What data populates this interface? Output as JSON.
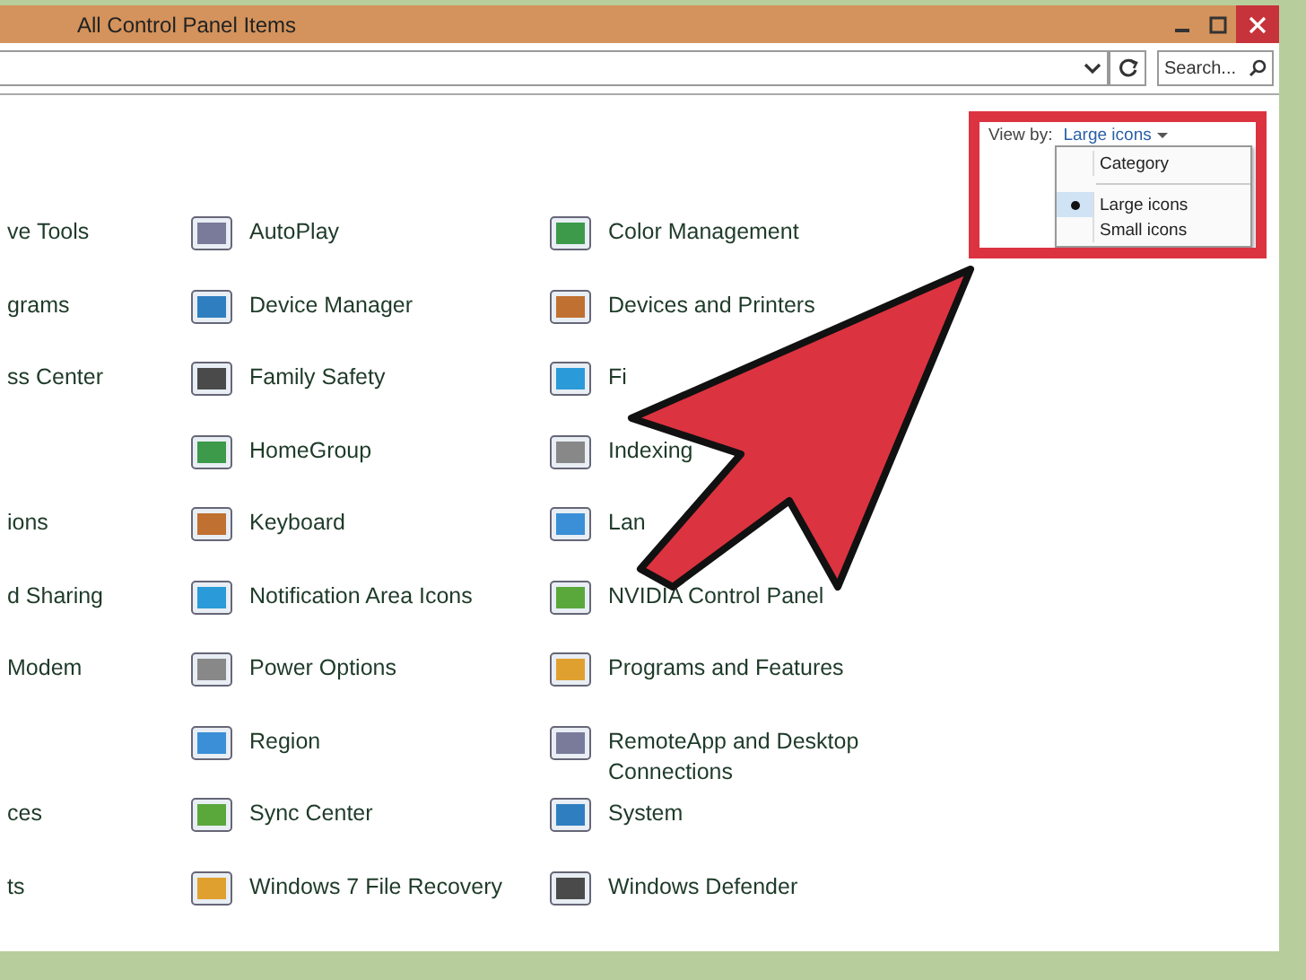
{
  "window": {
    "title": "All Control Panel Items"
  },
  "address_bar": {
    "search_placeholder": "Search..."
  },
  "view_by": {
    "label": "View by:",
    "value": "Large icons"
  },
  "view_menu": [
    [
      {
        "label": "Category",
        "selected": false
      }
    ],
    [
      {
        "label": "Large icons",
        "selected": true
      },
      {
        "label": "Small icons",
        "selected": false
      }
    ]
  ],
  "columns": [
    [
      "ve Tools",
      "grams",
      "ss Center",
      null,
      "ions",
      "d Sharing",
      "Modem",
      null,
      "ces",
      "ts"
    ],
    [
      "AutoPlay",
      "Device Manager",
      "Family Safety",
      "HomeGroup",
      "Keyboard",
      "Notification Area Icons",
      "Power Options",
      "Region",
      "Sync Center",
      "Windows 7 File Recovery"
    ],
    [
      "Color Management",
      "Devices and Printers",
      "Fi",
      "Indexing",
      "Lan",
      "NVIDIA Control Panel",
      "Programs and Features",
      "RemoteApp and Desktop Connections",
      "System",
      "Windows Defender"
    ]
  ]
}
